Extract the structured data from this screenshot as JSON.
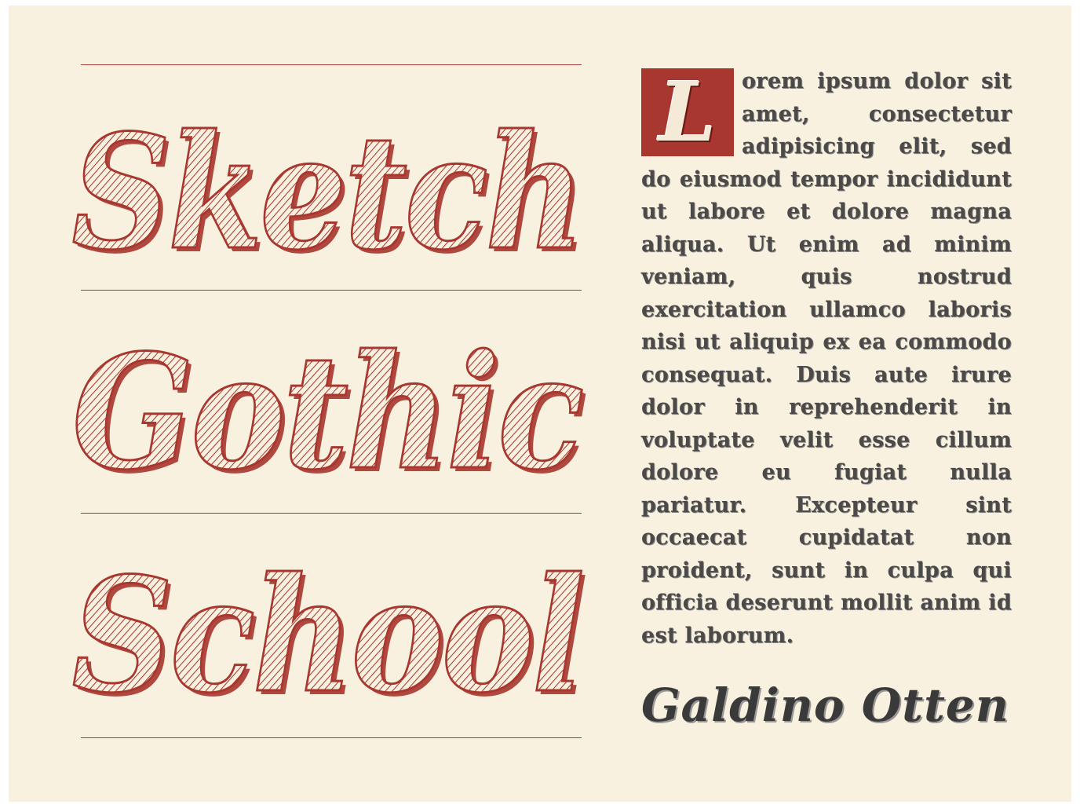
{
  "title_words": [
    "Sketch",
    "Gothic",
    "School"
  ],
  "body": {
    "dropcap": "L",
    "text": "orem ipsum dolor sit amet, consectetur adipisicing elit, sed do eiusmod tempor incididunt ut labore et dolore magna aliqua. Ut enim ad minim veniam, quis nostrud exercitation ullamco laboris nisi ut aliquip ex ea commodo consequat. Duis aute irure dolor in reprehenderit in voluptate velit esse cillum dolore eu fugiat nulla pariatur. Excepteur sint occaecat cupidatat non proident, sunt in culpa qui officia deserunt mollit anim id est laborum."
  },
  "author": "Galdino Otten",
  "colors": {
    "background": "#f8f1e0",
    "accent_red": "#a8372f",
    "ink_gray": "#4b4a49"
  }
}
